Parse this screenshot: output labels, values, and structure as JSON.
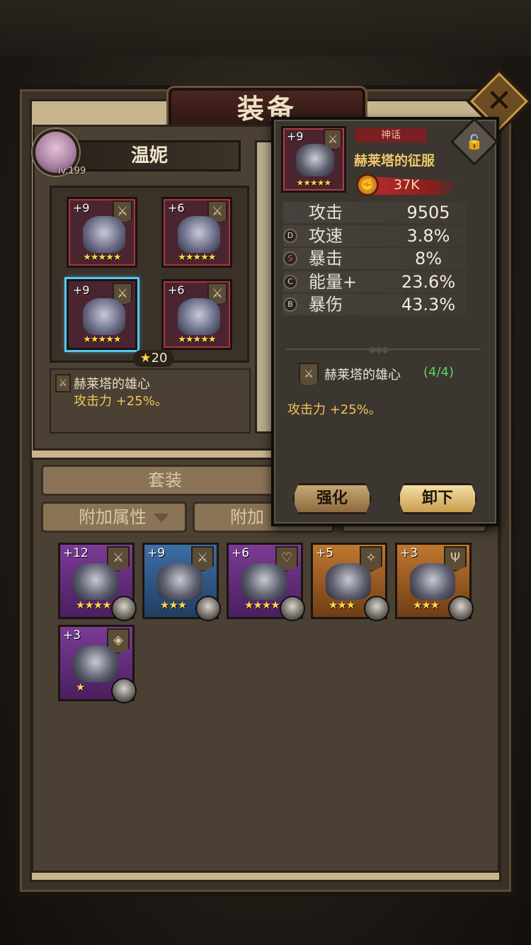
{
  "header": {
    "title": "装备",
    "close_icon": "close-icon"
  },
  "hero": {
    "name": "温妮",
    "level": "lv.199"
  },
  "equipped_slots": [
    {
      "level": "+9",
      "stars": "★★★★★",
      "type_icon": "sword-icon",
      "selected": false
    },
    {
      "level": "+6",
      "stars": "★★★★★",
      "type_icon": "sword-icon",
      "selected": false
    },
    {
      "level": "+9",
      "stars": "★★★★★",
      "type_icon": "sword-icon",
      "selected": true
    },
    {
      "level": "+6",
      "stars": "★★★★★",
      "type_icon": "sword-icon",
      "selected": false
    }
  ],
  "star_total": "20",
  "set_info": {
    "name": "赫莱塔的雄心",
    "bonus": "攻击力 +25%。"
  },
  "inventory": {
    "tab_suit": "套装",
    "filters": [
      "附加属性",
      "附加"
    ],
    "items": [
      {
        "level": "+12",
        "stars": "★★★★",
        "rarity": "purple",
        "type_icon": "sword-icon"
      },
      {
        "level": "+9",
        "stars": "★★★",
        "rarity": "blue",
        "type_icon": "sword-icon"
      },
      {
        "level": "+6",
        "stars": "★★★★",
        "rarity": "purple",
        "type_icon": "heart-icon"
      },
      {
        "level": "+5",
        "stars": "★★★",
        "rarity": "orange",
        "type_icon": "shuriken-icon"
      },
      {
        "level": "+3",
        "stars": "★★★",
        "rarity": "orange",
        "type_icon": "claw-icon"
      },
      {
        "level": "+3",
        "stars": "★",
        "rarity": "purple",
        "type_icon": "diamond-icon"
      }
    ]
  },
  "popup": {
    "level": "+9",
    "stars": "★★★★★",
    "rarity_label": "神话",
    "item_name": "赫莱塔的征服",
    "power": "37K",
    "stats": [
      {
        "badge": "",
        "label": "攻击",
        "value": "9505"
      },
      {
        "badge": "D",
        "label": "攻速",
        "value": "3.8%"
      },
      {
        "badge": "S",
        "label": "暴击",
        "value": "8%"
      },
      {
        "badge": "C",
        "label": "能量+",
        "value": "23.6%"
      },
      {
        "badge": "B",
        "label": "暴伤",
        "value": "43.3%"
      }
    ],
    "set_name": "赫莱塔的雄心",
    "set_count": "(4/4)",
    "set_bonus": "攻击力 +25%。",
    "upgrade_label": "强化",
    "unequip_label": "卸下"
  }
}
